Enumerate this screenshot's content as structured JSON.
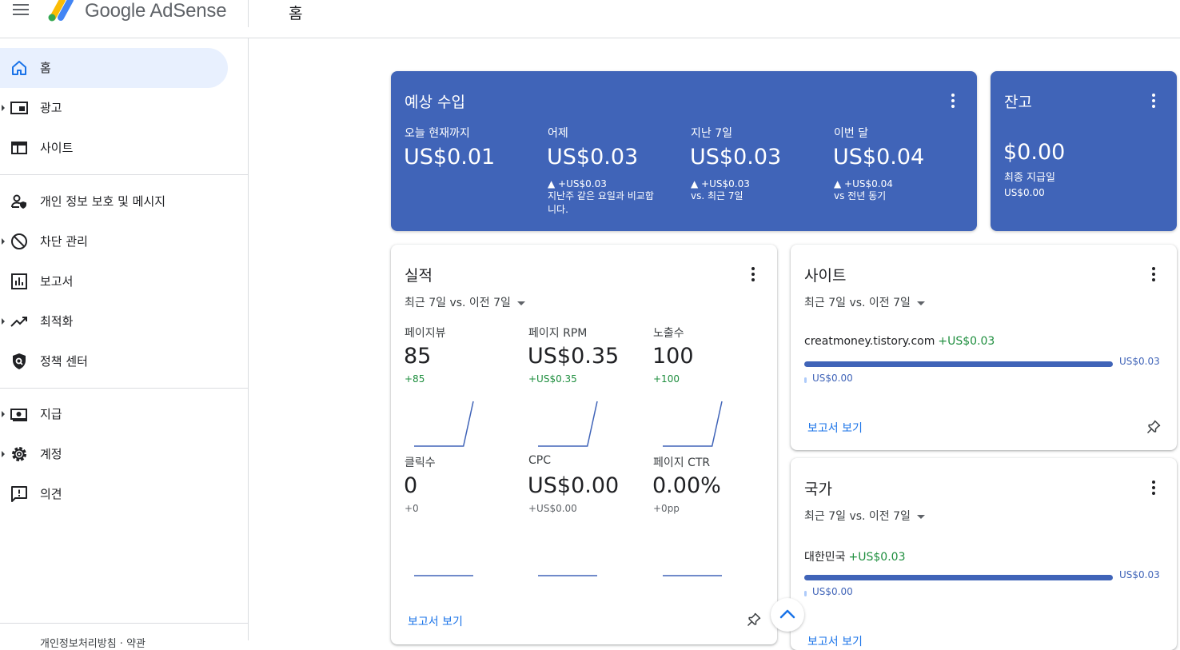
{
  "header": {
    "brand": "Google AdSense",
    "page_title": "홈",
    "icons": {
      "menu": "hamburger-icon",
      "logo": "adsense-logo"
    }
  },
  "sidebar": {
    "items": [
      {
        "label": "홈",
        "icon": "home-icon",
        "active": true,
        "expandable": false
      },
      {
        "label": "광고",
        "icon": "ads-icon",
        "expandable": true
      },
      {
        "label": "사이트",
        "icon": "sites-icon",
        "expandable": false
      },
      {
        "label": "개인 정보 보호 및 메시지",
        "icon": "privacy-messaging-icon",
        "expandable": false
      },
      {
        "label": "차단 관리",
        "icon": "block-icon",
        "expandable": true
      },
      {
        "label": "보고서",
        "icon": "reports-icon",
        "expandable": false
      },
      {
        "label": "최적화",
        "icon": "optimization-icon",
        "expandable": true
      },
      {
        "label": "정책 센터",
        "icon": "policy-center-icon",
        "expandable": false
      },
      {
        "label": "지급",
        "icon": "payments-icon",
        "expandable": true
      },
      {
        "label": "계정",
        "icon": "settings-icon",
        "expandable": true
      },
      {
        "label": "의견",
        "icon": "feedback-icon",
        "expandable": false
      }
    ],
    "footer": "개인정보처리방침 · 약관"
  },
  "earnings": {
    "title": "예상 수입",
    "metrics": [
      {
        "label": "오늘 현재까지",
        "value": "US$0.01",
        "note1": "",
        "note2": "",
        "note3": ""
      },
      {
        "label": "어제",
        "value": "US$0.03",
        "note1": "▲ +US$0.03",
        "note2": "지난주 같은 요일과 비교합",
        "note3": "니다."
      },
      {
        "label": "지난 7일",
        "value": "US$0.03",
        "note1": "▲ +US$0.03",
        "note2": "vs. 최근 7일",
        "note3": ""
      },
      {
        "label": "이번 달",
        "value": "US$0.04",
        "note1": "▲ +US$0.04",
        "note2": "vs 전년 동기",
        "note3": ""
      }
    ]
  },
  "balance": {
    "title": "잔고",
    "value": "$0.00",
    "last_payment_label": "최종 지급일",
    "last_payment_value": "US$0.00"
  },
  "performance": {
    "title": "실적",
    "period": "최근 7일 vs. 이전 7일",
    "metrics": [
      {
        "label": "페이지뷰",
        "value": "85",
        "change": "+85",
        "trend": [
          0,
          0,
          0,
          0,
          0,
          0,
          85
        ]
      },
      {
        "label": "페이지 RPM",
        "value": "US$0.35",
        "change": "+US$0.35",
        "trend": [
          0,
          0,
          0,
          0,
          0,
          0,
          0.35
        ]
      },
      {
        "label": "노출수",
        "value": "100",
        "change": "+100",
        "trend": [
          0,
          0,
          0,
          0,
          0,
          0,
          100
        ]
      },
      {
        "label": "클릭수",
        "value": "0",
        "change": "+0",
        "trend": [
          0,
          0,
          0,
          0,
          0,
          0,
          0
        ]
      },
      {
        "label": "CPC",
        "value": "US$0.00",
        "change": "+US$0.00",
        "trend": [
          0,
          0,
          0,
          0,
          0,
          0,
          0
        ]
      },
      {
        "label": "페이지 CTR",
        "value": "0.00%",
        "change": "+0pp",
        "trend": [
          0,
          0,
          0,
          0,
          0,
          0,
          0
        ]
      }
    ],
    "report_link": "보고서 보기"
  },
  "sites": {
    "title": "사이트",
    "period": "최근 7일 vs. 이전 7일",
    "rows": [
      {
        "name": "creatmoney.tistory.com",
        "change": "+US$0.03",
        "current": "US$0.03",
        "previous": "US$0.00",
        "current_fraction": 1.0
      }
    ],
    "report_link": "보고서 보기"
  },
  "countries": {
    "title": "국가",
    "period": "최근 7일 vs. 이전 7일",
    "rows": [
      {
        "name": "대한민국",
        "change": "+US$0.03",
        "current": "US$0.03",
        "previous": "US$0.00",
        "current_fraction": 1.0
      }
    ],
    "report_link": "보고서 보기"
  },
  "colors": {
    "accent": "#4064b8",
    "positive": "#1e8e3e",
    "link": "#1a73e8",
    "active_nav": "#e8f0fe"
  }
}
